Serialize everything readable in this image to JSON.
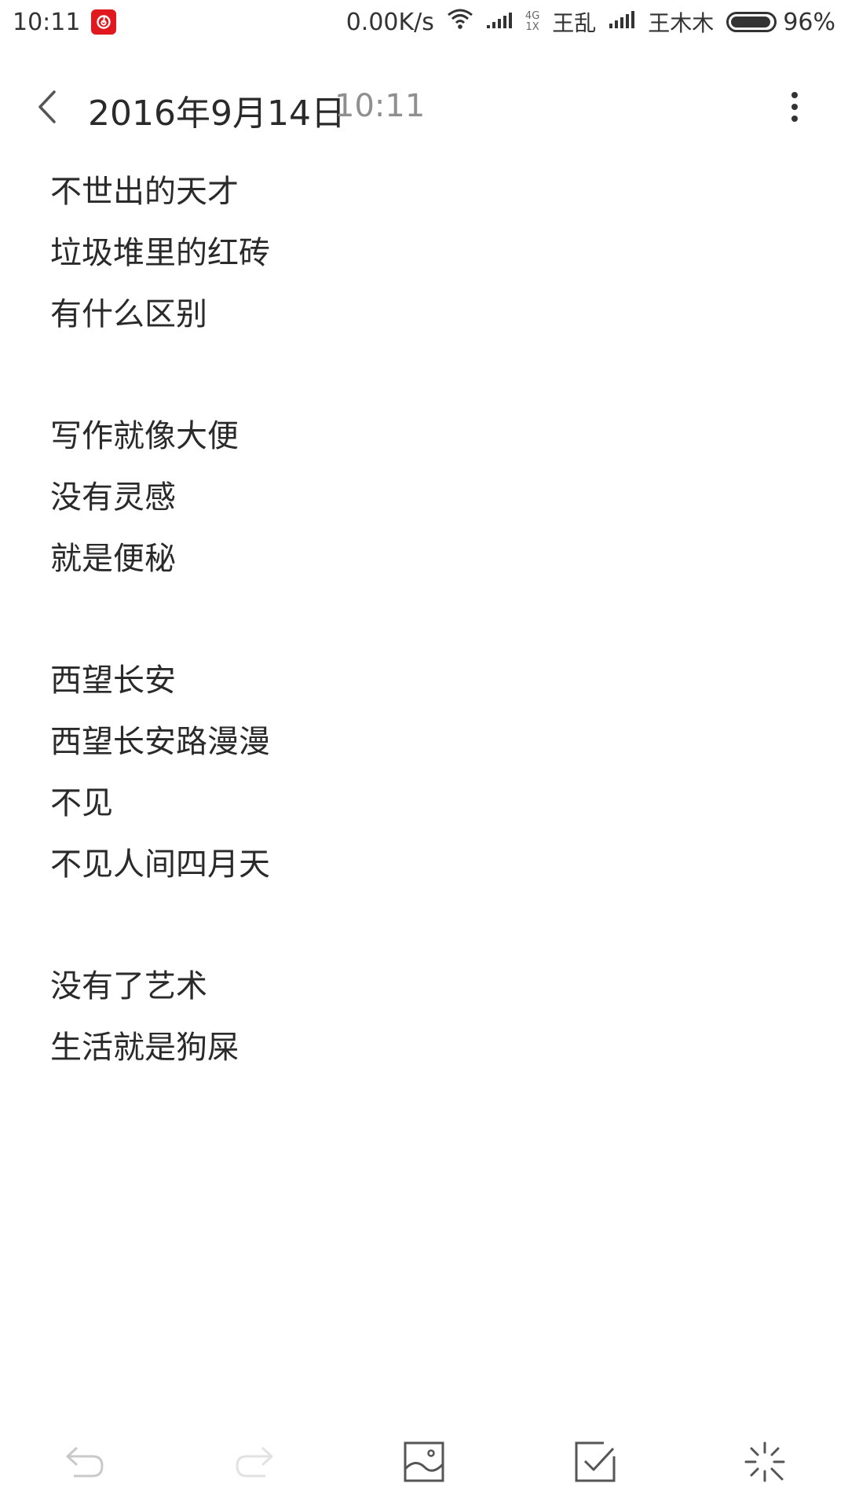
{
  "status_bar": {
    "time": "10:11",
    "net_speed": "0.00K/s",
    "net_type_top": "4G",
    "net_type_bottom": "1X",
    "carrier1": "王乱",
    "carrier2": "王木木",
    "battery": "96%",
    "battery_level": 0.96
  },
  "header": {
    "date": "2016年9月14日",
    "time": "10:11"
  },
  "note": {
    "lines": [
      "不世出的天才",
      "垃圾堆里的红砖",
      "有什么区别",
      "",
      "写作就像大便",
      "没有灵感",
      "就是便秘",
      "",
      "西望长安",
      "西望长安路漫漫",
      "不见",
      "不见人间四月天",
      "",
      "没有了艺术",
      "生活就是狗屎"
    ]
  },
  "toolbar": {
    "icons": [
      "undo-icon",
      "redo-icon",
      "insert-image-icon",
      "checklist-icon",
      "magic-icon"
    ]
  }
}
